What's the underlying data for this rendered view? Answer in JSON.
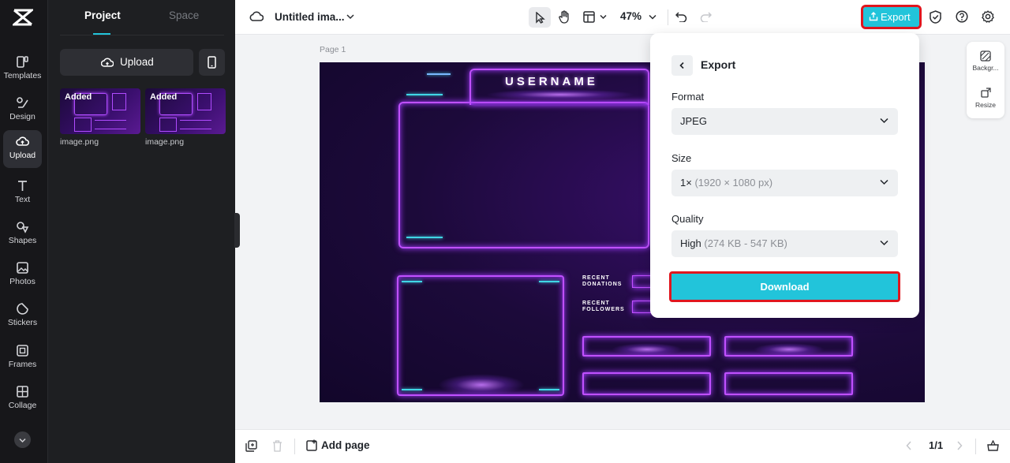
{
  "rail": {
    "items": [
      {
        "label": "Templates",
        "icon": "templates-icon"
      },
      {
        "label": "Design",
        "icon": "design-icon"
      },
      {
        "label": "Upload",
        "icon": "upload-cloud-icon"
      },
      {
        "label": "Text",
        "icon": "text-icon"
      },
      {
        "label": "Shapes",
        "icon": "shapes-icon"
      },
      {
        "label": "Photos",
        "icon": "photos-icon"
      },
      {
        "label": "Stickers",
        "icon": "stickers-icon"
      },
      {
        "label": "Frames",
        "icon": "frames-icon"
      },
      {
        "label": "Collage",
        "icon": "collage-icon"
      }
    ],
    "active": "Upload"
  },
  "panel": {
    "tabs": [
      "Project",
      "Space"
    ],
    "upload_label": "Upload",
    "thumbnails": [
      {
        "badge": "Added",
        "name": "image.png"
      },
      {
        "badge": "Added",
        "name": "image.png"
      }
    ]
  },
  "topbar": {
    "doc_title": "Untitled ima...",
    "zoom": "47%",
    "export_label": "Export"
  },
  "canvas": {
    "page_label": "Page 1",
    "username": "USERNAME",
    "recent_donations": "RECENT\nDONATIONS",
    "recent_followers": "RECENT\nFOLLOWERS"
  },
  "mini_panel": {
    "background_label": "Backgr...",
    "resize_label": "Resize"
  },
  "export_panel": {
    "title": "Export",
    "format_label": "Format",
    "format_value": "JPEG",
    "size_label": "Size",
    "size_value": "1×",
    "size_detail": "(1920 × 1080 px)",
    "quality_label": "Quality",
    "quality_value": "High",
    "quality_detail": "(274 KB - 547 KB)",
    "download_label": "Download"
  },
  "bottombar": {
    "add_page_label": "Add page",
    "pager": "1/1"
  },
  "colors": {
    "accent": "#22c4da",
    "highlight": "#e0161e",
    "rail_bg": "#17171a",
    "panel_bg": "#1e1f22",
    "neon": "#c050ff"
  }
}
